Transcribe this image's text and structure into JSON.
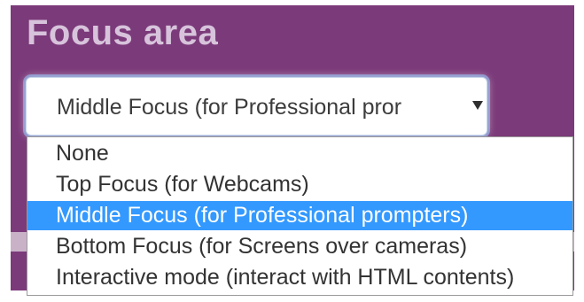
{
  "panel": {
    "title": "Focus area"
  },
  "select": {
    "current_value": "Middle Focus (for Professional pror"
  },
  "dropdown": {
    "options": [
      {
        "label": "None"
      },
      {
        "label": "Top Focus (for Webcams)"
      },
      {
        "label": "Middle Focus (for Professional prompters)"
      },
      {
        "label": "Bottom Focus (for Screens over cameras)"
      },
      {
        "label": "Interactive mode (interact with HTML contents)"
      }
    ],
    "selected_index": 2
  },
  "colors": {
    "panel_bg": "#7b3a7a",
    "title": "#d7c3db",
    "highlight": "#3399ff"
  },
  "icons": {
    "select_arrow": "triangle-down-icon"
  }
}
